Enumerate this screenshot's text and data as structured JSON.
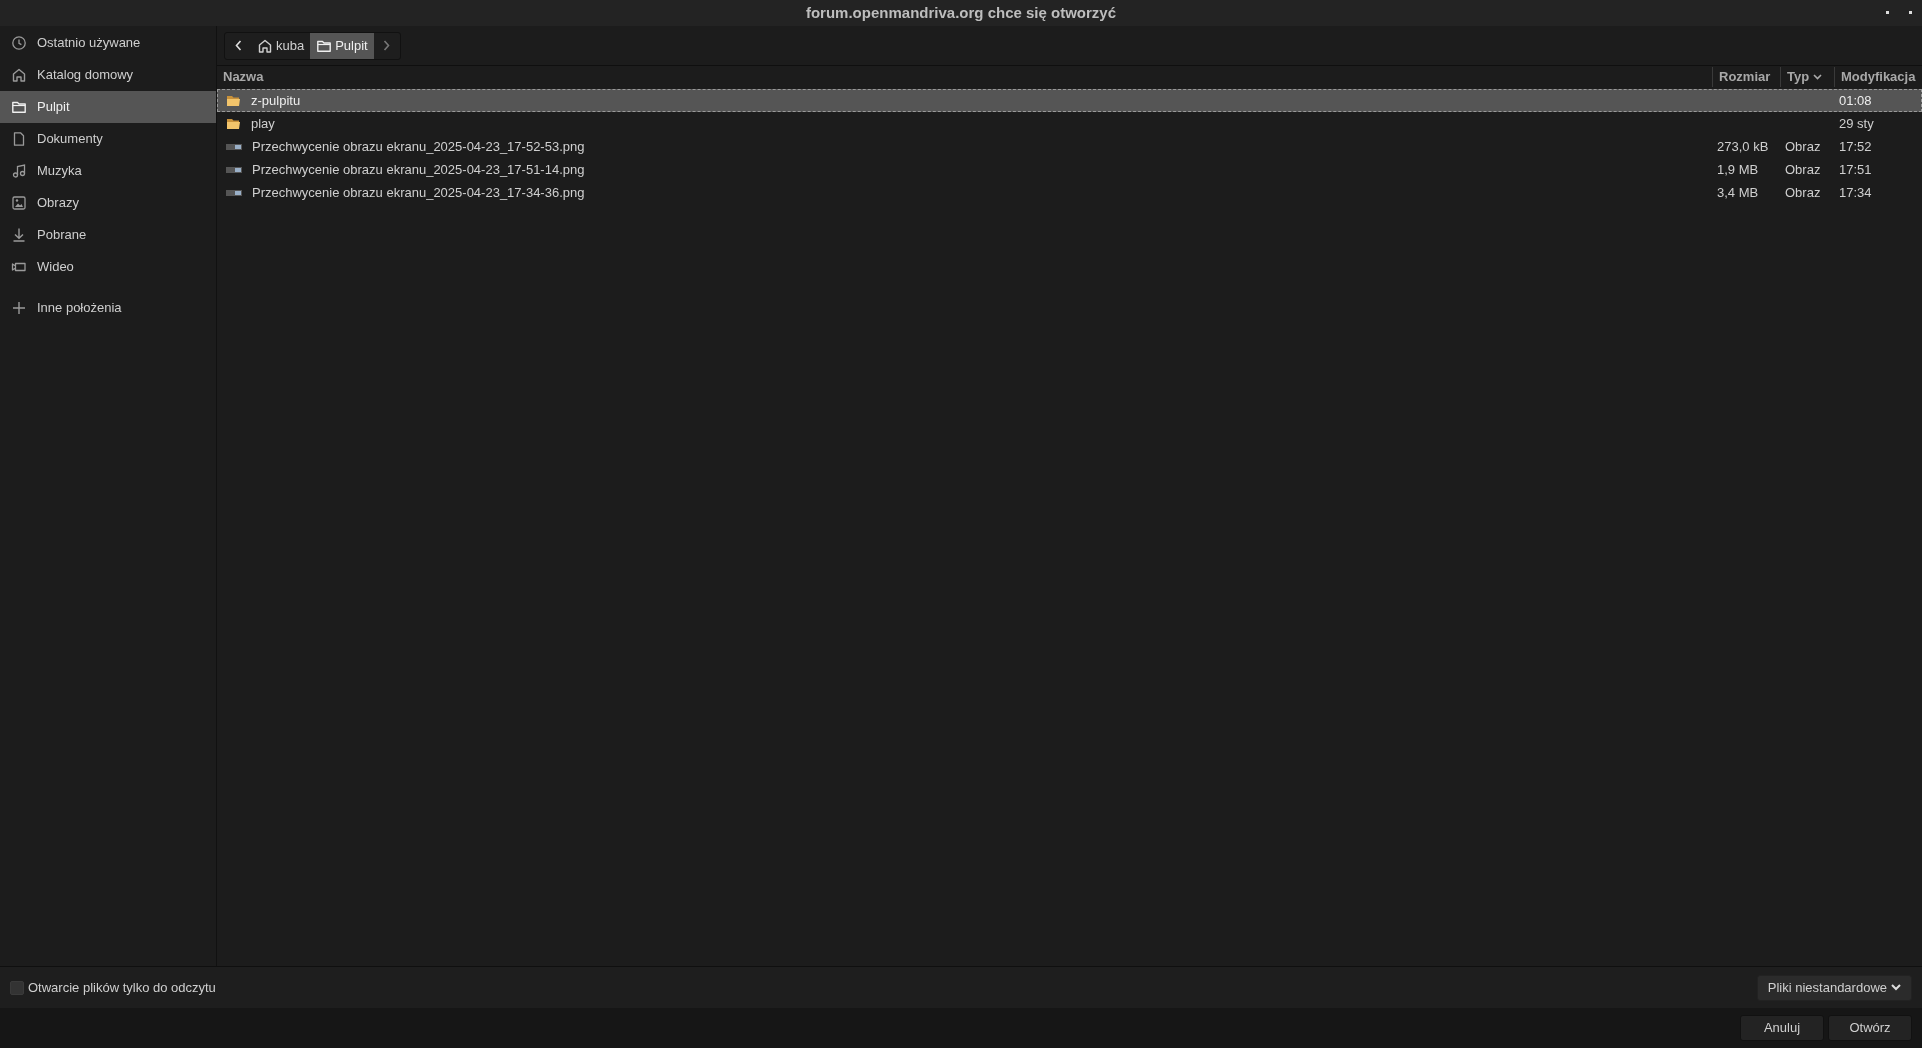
{
  "window": {
    "title": "forum.openmandriva.org chce się otworzyć"
  },
  "sidebar": {
    "items": [
      {
        "kind": "clock",
        "label": "Ostatnio używane",
        "selected": false
      },
      {
        "kind": "home",
        "label": "Katalog domowy",
        "selected": false
      },
      {
        "kind": "folder",
        "label": "Pulpit",
        "selected": true
      },
      {
        "kind": "document",
        "label": "Dokumenty",
        "selected": false
      },
      {
        "kind": "music",
        "label": "Muzyka",
        "selected": false
      },
      {
        "kind": "image",
        "label": "Obrazy",
        "selected": false
      },
      {
        "kind": "download",
        "label": "Pobrane",
        "selected": false
      },
      {
        "kind": "video",
        "label": "Wideo",
        "selected": false
      }
    ],
    "other": {
      "kind": "plus",
      "label": "Inne położenia"
    }
  },
  "path_bar": {
    "items": [
      {
        "kind": "home",
        "label": "kuba",
        "selected": false
      },
      {
        "kind": "folder",
        "label": "Pulpit",
        "selected": true
      }
    ]
  },
  "table": {
    "columns": [
      "Nazwa",
      "Rozmiar",
      "Typ",
      "Modyfikacja"
    ],
    "rows": [
      {
        "kind": "folder",
        "name": "z-pulpitu",
        "size": "",
        "type": "",
        "modified": "01:08",
        "selected": true
      },
      {
        "kind": "folder",
        "name": "play",
        "size": "",
        "type": "",
        "modified": "29 sty",
        "selected": false
      },
      {
        "kind": "image",
        "name": "Przechwycenie obrazu ekranu_2025-04-23_17-52-53.png",
        "size": "273,0 kB",
        "type": "Obraz",
        "modified": "17:52",
        "selected": false
      },
      {
        "kind": "image",
        "name": "Przechwycenie obrazu ekranu_2025-04-23_17-51-14.png",
        "size": "1,9 MB",
        "type": "Obraz",
        "modified": "17:51",
        "selected": false
      },
      {
        "kind": "image",
        "name": "Przechwycenie obrazu ekranu_2025-04-23_17-34-36.png",
        "size": "3,4 MB",
        "type": "Obraz",
        "modified": "17:34",
        "selected": false
      }
    ]
  },
  "read_only": {
    "label": "Otwarcie plików tylko do odczytu",
    "checked": false
  },
  "filter": {
    "label": "Pliki niestandardowe"
  },
  "buttons": [
    "Anuluj",
    "Otwórz"
  ]
}
